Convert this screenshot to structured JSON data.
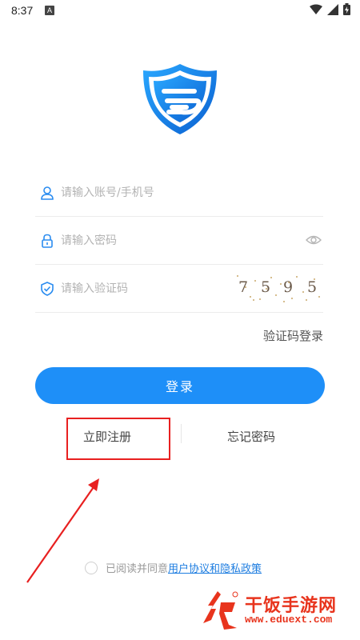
{
  "status_bar": {
    "time": "8:37",
    "notification_letter": "A"
  },
  "form": {
    "account_placeholder": "请输入账号/手机号",
    "password_placeholder": "请输入密码",
    "captcha_placeholder": "请输入验证码",
    "captcha_chars": [
      "7",
      "5",
      "9",
      "5"
    ],
    "code_login_label": "验证码登录",
    "login_button": "登录"
  },
  "links": {
    "register": "立即注册",
    "forgot_password": "忘记密码"
  },
  "agreement": {
    "prefix": "已阅读并同意",
    "policy_link": "用户协议和隐私政策"
  },
  "watermark": {
    "name": "干饭手游网",
    "url": "www.eduext.com"
  },
  "colors": {
    "accent": "#1e8ff8",
    "annotation": "#e82020",
    "watermark": "#e8341d"
  }
}
